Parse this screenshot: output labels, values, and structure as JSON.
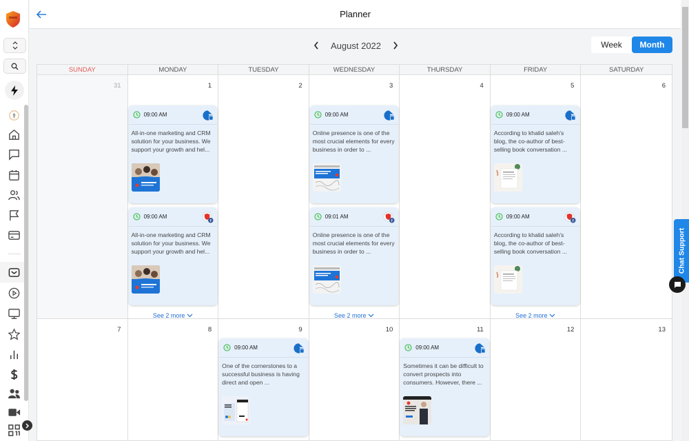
{
  "header": {
    "title": "Planner",
    "back_label": "Back"
  },
  "sidebar": {
    "items": [
      {
        "name": "logo",
        "icon": "shield-logo"
      },
      {
        "name": "workspace-switcher",
        "icon": "chevron-up-down-icon"
      },
      {
        "name": "search",
        "icon": "search-icon"
      },
      {
        "name": "quick-actions",
        "icon": "lightning-icon"
      },
      {
        "name": "launchpad",
        "icon": "rocket-icon"
      },
      {
        "name": "dashboard",
        "icon": "home-icon"
      },
      {
        "name": "conversations",
        "icon": "chat-icon"
      },
      {
        "name": "calendars",
        "icon": "calendar-icon"
      },
      {
        "name": "contacts",
        "icon": "users-icon"
      },
      {
        "name": "opportunities",
        "icon": "flag-icon"
      },
      {
        "name": "payments",
        "icon": "card-icon"
      },
      {
        "name": "marketing",
        "icon": "mail-icon"
      },
      {
        "name": "automation",
        "icon": "play-icon"
      },
      {
        "name": "sites",
        "icon": "monitor-icon"
      },
      {
        "name": "reputation",
        "icon": "star-icon"
      },
      {
        "name": "reporting",
        "icon": "bar-chart-icon"
      },
      {
        "name": "billing",
        "icon": "dollar-icon"
      },
      {
        "name": "memberships",
        "icon": "people-icon"
      },
      {
        "name": "videos",
        "icon": "video-icon"
      },
      {
        "name": "qr-codes",
        "icon": "qr-icon"
      }
    ]
  },
  "toolbar": {
    "month_label": "August 2022",
    "prev_icon": "‹",
    "next_icon": "›",
    "views": [
      {
        "label": "Week",
        "active": false
      },
      {
        "label": "Month",
        "active": true
      }
    ]
  },
  "calendar": {
    "weekdays": [
      "SUNDAY",
      "MONDAY",
      "TUESDAY",
      "WEDNESDAY",
      "THURSDAY",
      "FRIDAY",
      "SATURDAY"
    ],
    "weeks": [
      {
        "days": [
          {
            "num": "31",
            "outside": true
          },
          {
            "num": "1"
          },
          {
            "num": "2"
          },
          {
            "num": "3"
          },
          {
            "num": "4"
          },
          {
            "num": "5"
          },
          {
            "num": "6"
          }
        ]
      },
      {
        "days": [
          {
            "num": "7"
          },
          {
            "num": "8"
          },
          {
            "num": "9"
          },
          {
            "num": "10"
          },
          {
            "num": "11"
          },
          {
            "num": "12"
          },
          {
            "num": "13"
          }
        ]
      }
    ],
    "posts": {
      "mon1_a": {
        "time": "09:00 AM",
        "platform": "google-business",
        "text": "All-in-one marketing and CRM solution for your business. We support your growth and hel..."
      },
      "mon1_b": {
        "time": "09:00 AM",
        "platform": "facebook",
        "text": "All-in-one marketing and CRM solution for your business. We support your growth and hel..."
      },
      "wed3_a": {
        "time": "09:00 AM",
        "platform": "google-business",
        "text": "Online presence is one of the most crucial elements for every business in order to ..."
      },
      "wed3_b": {
        "time": "09:01 AM",
        "platform": "facebook",
        "text": "Online presence is one of the most crucial elements for every business in order to ..."
      },
      "fri5_a": {
        "time": "09:00 AM",
        "platform": "google-business",
        "text": "According to khalid saleh's blog, the co-author of best-selling book conversation ..."
      },
      "fri5_b": {
        "time": "09:00 AM",
        "platform": "facebook",
        "text": "According to khalid saleh's blog, the co-author of best-selling book conversation ..."
      },
      "tue9": {
        "time": "09:00 AM",
        "platform": "google-business",
        "text": "One of the cornerstones to a successful business is having direct and open ..."
      },
      "thu11": {
        "time": "09:00 AM",
        "platform": "google-business",
        "text": "Sometimes it can be difficult to convert prospects into consumers. However, there ..."
      }
    },
    "see_more_label": "See 2 more"
  },
  "chat_support": {
    "label": "Chat Support"
  },
  "colors": {
    "accent": "#1f87e8",
    "sunday": "#e15a5a",
    "card_bg": "#e6f0fb",
    "clock_green": "#3cb55a"
  }
}
